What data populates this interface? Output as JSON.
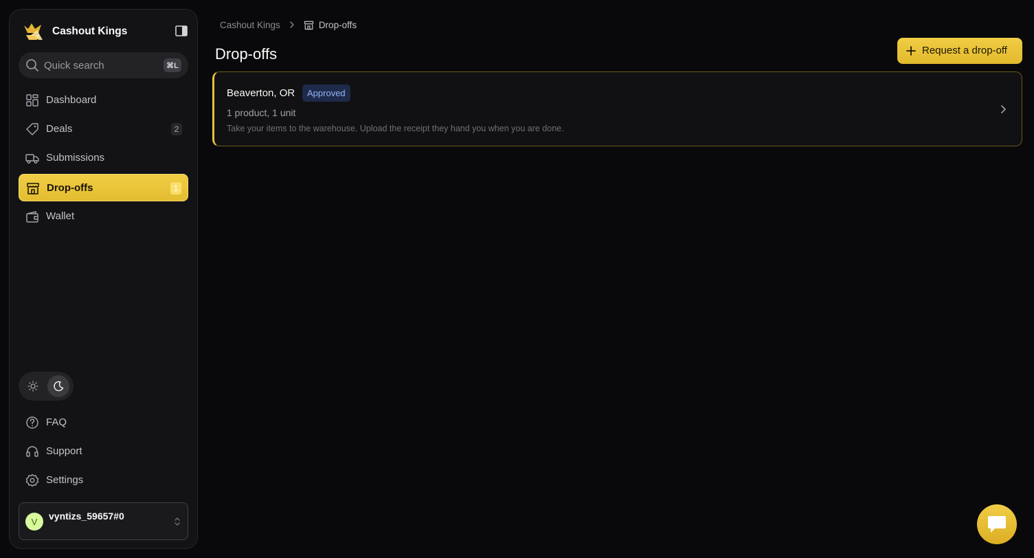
{
  "app": {
    "name": "Cashout Kings"
  },
  "search": {
    "placeholder": "Quick search",
    "shortcut": "⌘L"
  },
  "nav": {
    "items": [
      {
        "label": "Dashboard",
        "icon": "dashboard-icon"
      },
      {
        "label": "Deals",
        "icon": "tag-icon",
        "badge": "2"
      },
      {
        "label": "Submissions",
        "icon": "truck-icon"
      },
      {
        "label": "Drop-offs",
        "icon": "store-icon",
        "badge": "1",
        "active": true
      },
      {
        "label": "Wallet",
        "icon": "wallet-icon"
      }
    ],
    "footer": [
      {
        "label": "FAQ",
        "icon": "help-circle-icon"
      },
      {
        "label": "Support",
        "icon": "headset-icon"
      },
      {
        "label": "Settings",
        "icon": "gear-icon"
      }
    ]
  },
  "theme": {
    "selected": "dark"
  },
  "user": {
    "initial": "V",
    "name": "vyntizs_59657#0"
  },
  "breadcrumb": {
    "root": "Cashout Kings",
    "current": "Drop-offs"
  },
  "page": {
    "title": "Drop-offs",
    "primary_action": "Request a drop-off"
  },
  "dropoffs": [
    {
      "location": "Beaverton, OR",
      "status": "Approved",
      "summary": "1 product, 1 unit",
      "description": "Take your items to the warehouse. Upload the receipt they hand you when you are done."
    }
  ],
  "colors": {
    "accent": "#e9c43c",
    "background": "#09090b",
    "sidebar": "#131316",
    "status_approved_bg": "#1e2a4a",
    "status_approved_text": "#93b4f5"
  }
}
